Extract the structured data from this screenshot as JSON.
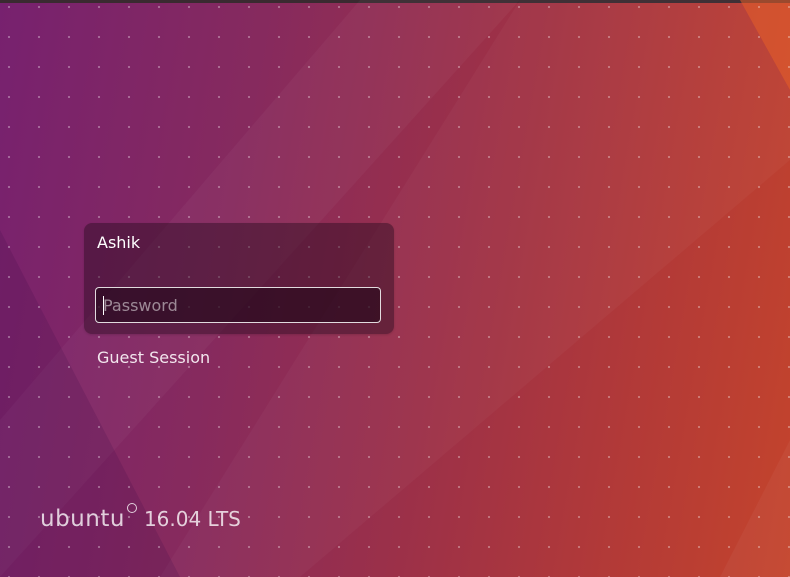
{
  "greeter": {
    "username": "Ashik",
    "password_placeholder": "Password",
    "guest_session_label": "Guest Session"
  },
  "branding": {
    "logo_text": "ubuntu",
    "version": "16.04 LTS"
  },
  "colors": {
    "background_left": "#77216f",
    "background_right": "#c4442c",
    "greeter_panel": "#3a1530",
    "text": "#ffffff"
  }
}
